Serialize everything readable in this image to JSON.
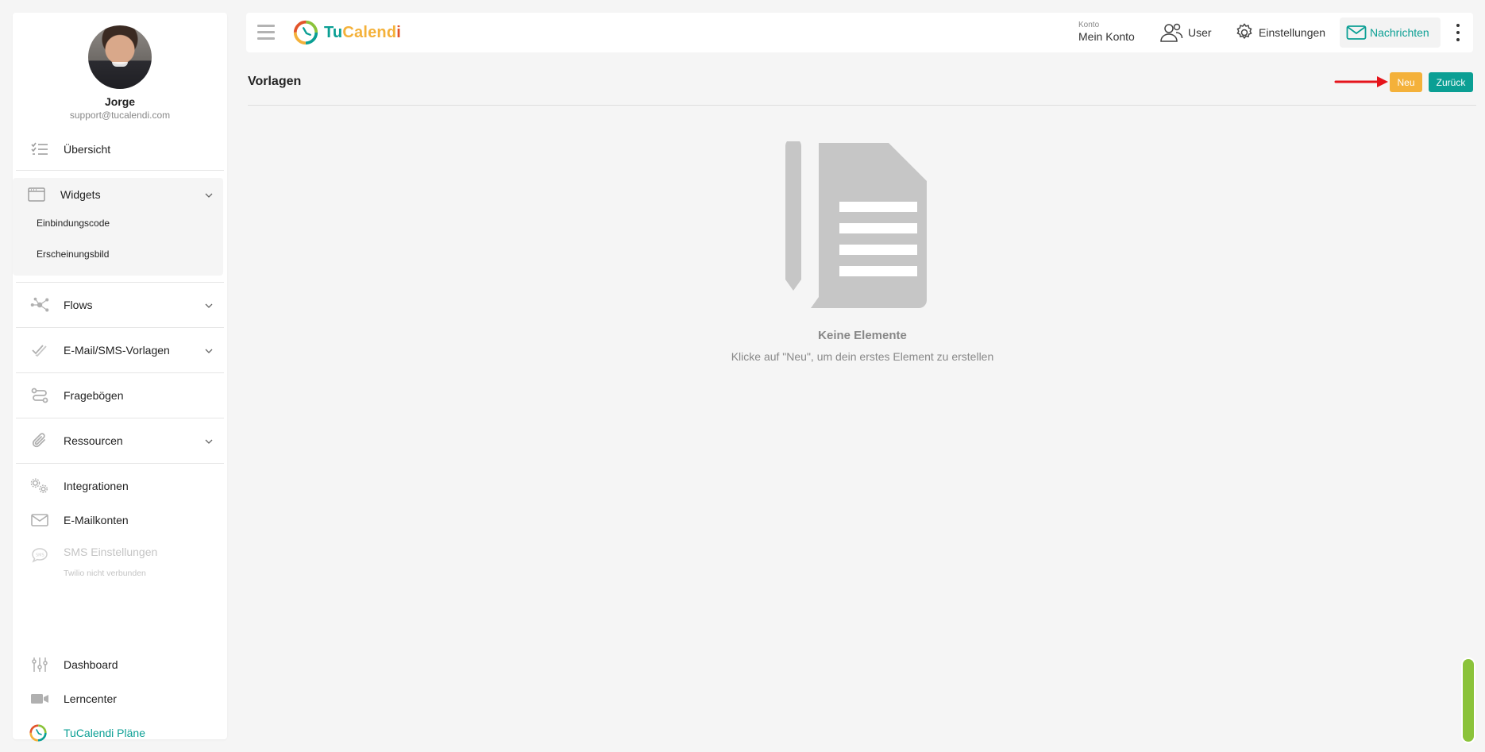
{
  "profile": {
    "name": "Jorge",
    "email": "support@tucalendi.com"
  },
  "sidebar": {
    "overview": "Übersicht",
    "widgets": {
      "label": "Widgets",
      "items": [
        "Einbindungscode",
        "Erscheinungsbild"
      ]
    },
    "flows": "Flows",
    "email_sms_templates": "E-Mail/SMS-Vorlagen",
    "questionnaires": "Fragebögen",
    "resources": "Ressourcen",
    "integrations": "Integrationen",
    "email_accounts": "E-Mailkonten",
    "sms_settings": {
      "label": "SMS Einstellungen",
      "note": "Twilio nicht verbunden"
    },
    "dashboard": "Dashboard",
    "learning_center": "Lerncenter",
    "plans": "TuCalendi Pläne"
  },
  "topbar": {
    "logo": {
      "tu": "Tu",
      "calend": "Calend",
      "i": "i"
    },
    "account_small": "Konto",
    "account_big": "Mein Konto",
    "user": "User",
    "settings": "Einstellungen",
    "messages": "Nachrichten"
  },
  "main": {
    "title": "Vorlagen",
    "new_button": "Neu",
    "back_button": "Zurück",
    "empty_title": "Keine Elemente",
    "empty_subtitle": "Klicke auf \"Neu\", um dein erstes Element zu erstellen"
  },
  "colors": {
    "brand_teal": "#0b9f94",
    "brand_orange": "#f4b13a",
    "brand_red": "#e2542a",
    "annotation_arrow": "#e5141b",
    "scroll_indicator": "#8bc33a"
  }
}
